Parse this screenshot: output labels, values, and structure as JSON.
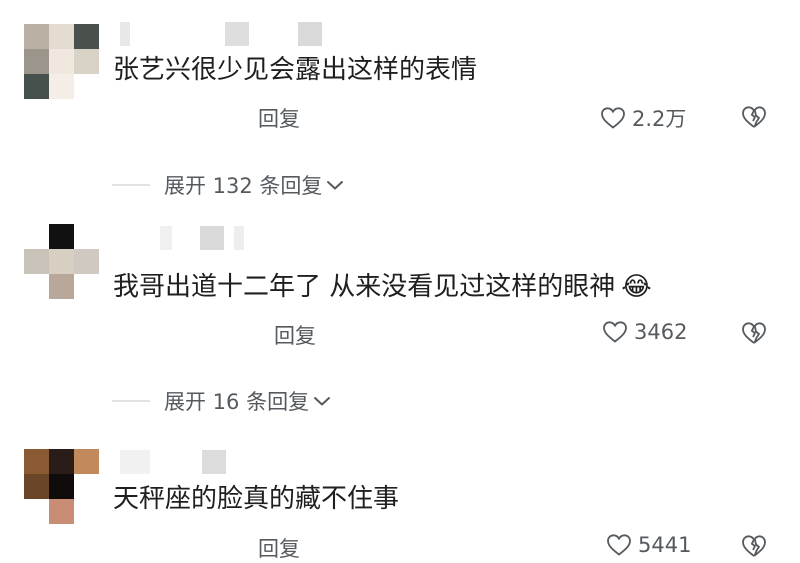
{
  "comments": [
    {
      "text": "张艺兴很少见会露出这样的表情",
      "reply_label": "回复",
      "likes": "2.2万",
      "expand_label": "展开 132 条回复"
    },
    {
      "text": "我哥出道十二年了 从来没看见过这样的眼神",
      "emoji": "😂",
      "reply_label": "回复",
      "likes": "3462",
      "expand_label": "展开 16 条回复"
    },
    {
      "text": "天秤座的脸真的藏不住事",
      "reply_label": "回复",
      "likes": "5441"
    }
  ],
  "icons": {
    "like": "heart-outline-icon",
    "dislike": "broken-heart-icon",
    "expand": "chevron-down-icon"
  },
  "colors": {
    "secondary_text": "#555a5f",
    "primary_text": "#1f1f1f",
    "divider": "#e3e3e3"
  }
}
